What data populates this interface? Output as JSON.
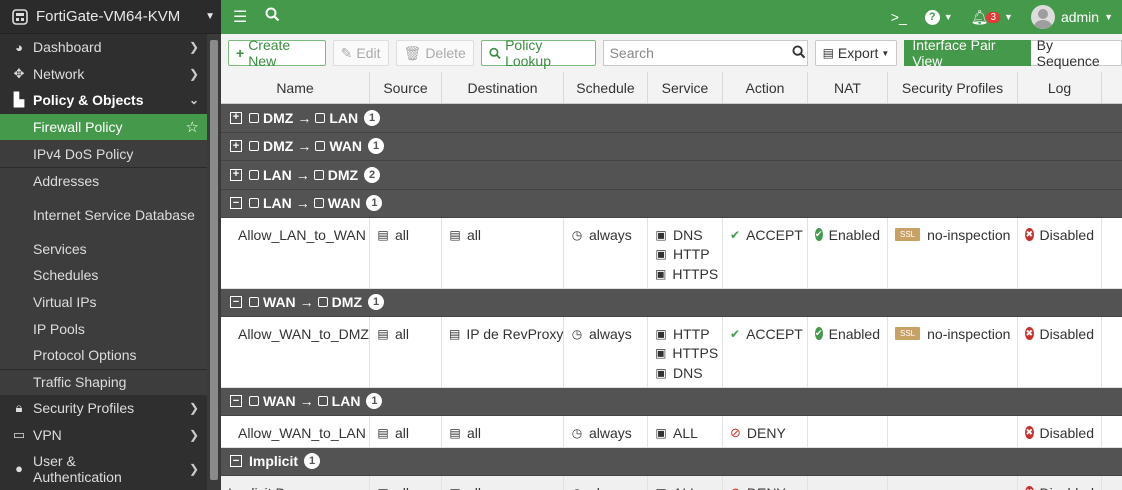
{
  "sidebar": {
    "device": "FortiGate-VM64-KVM",
    "items": [
      {
        "label": "Dashboard",
        "icon": "dashboard-icon"
      },
      {
        "label": "Network",
        "icon": "network-icon"
      },
      {
        "label": "Policy & Objects",
        "icon": "policy-icon"
      }
    ],
    "sub": [
      "Firewall Policy",
      "IPv4 DoS Policy",
      "Addresses",
      "Internet Service Database",
      "Services",
      "Schedules",
      "Virtual IPs",
      "IP Pools",
      "Protocol Options",
      "Traffic Shaping"
    ],
    "bottom": [
      {
        "label": "Security Profiles",
        "icon": "lock-icon"
      },
      {
        "label": "VPN",
        "icon": "monitor-icon"
      },
      {
        "label": "User & Authentication",
        "icon": "user-icon"
      }
    ]
  },
  "topbar": {
    "cli": ">_",
    "help": "?",
    "notifications": "3",
    "user": "admin"
  },
  "toolbar": {
    "create": "Create New",
    "edit": "Edit",
    "delete": "Delete",
    "lookup": "Policy Lookup",
    "search_placeholder": "Search",
    "export": "Export",
    "view_interface": "Interface Pair View",
    "view_sequence": "By Sequence"
  },
  "table": {
    "columns": [
      "Name",
      "Source",
      "Destination",
      "Schedule",
      "Service",
      "Action",
      "NAT",
      "Security Profiles",
      "Log"
    ],
    "groups": [
      {
        "from": "DMZ",
        "to": "LAN",
        "count": "1",
        "expanded": false,
        "toggle": "+"
      },
      {
        "from": "DMZ",
        "to": "WAN",
        "count": "1",
        "expanded": false,
        "toggle": "+"
      },
      {
        "from": "LAN",
        "to": "DMZ",
        "count": "2",
        "expanded": false,
        "toggle": "+"
      },
      {
        "from": "LAN",
        "to": "WAN",
        "count": "1",
        "expanded": true,
        "toggle": "−",
        "row": {
          "name": "Allow_LAN_to_WAN",
          "source": "all",
          "destination": "all",
          "schedule": "always",
          "services": [
            "DNS",
            "HTTP",
            "HTTPS"
          ],
          "action": "ACCEPT",
          "nat": "Enabled",
          "ssl": "SSL",
          "profile": "no-inspection",
          "log": "Disabled"
        }
      },
      {
        "from": "WAN",
        "to": "DMZ",
        "count": "1",
        "expanded": true,
        "toggle": "−",
        "row": {
          "name": "Allow_WAN_to_DMZ",
          "source": "all",
          "destination": "IP de RevProxy",
          "schedule": "always",
          "services": [
            "HTTP",
            "HTTPS",
            "DNS"
          ],
          "action": "ACCEPT",
          "nat": "Enabled",
          "ssl": "SSL",
          "profile": "no-inspection",
          "log": "Disabled"
        }
      },
      {
        "from": "WAN",
        "to": "LAN",
        "count": "1",
        "expanded": true,
        "toggle": "−",
        "row": {
          "name": "Allow_WAN_to_LAN",
          "source": "all",
          "destination": "all",
          "schedule": "always",
          "services": [
            "ALL"
          ],
          "action": "DENY",
          "nat": "",
          "profile": "",
          "log": "Disabled"
        }
      }
    ],
    "implicit": {
      "label": "Implicit",
      "count": "1",
      "toggle": "−",
      "row": {
        "name": "Implicit Deny",
        "source": "all",
        "destination": "all",
        "schedule": "always",
        "services": [
          "ALL"
        ],
        "action": "DENY",
        "log": "Disabled"
      }
    }
  },
  "colors": {
    "brand_green": "#449a4a",
    "sidebar": "#2f2f2f",
    "group_header": "#535353",
    "deny_red": "#c9302c",
    "ssl_badge": "#c8a165"
  }
}
